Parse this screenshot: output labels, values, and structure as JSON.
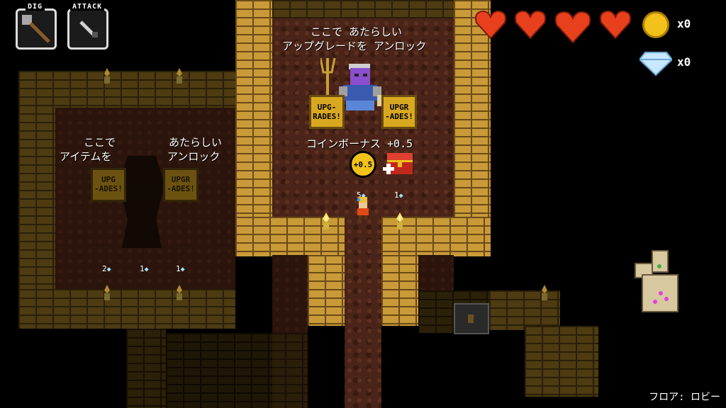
{
  "hud": {
    "dig_label": "DIG",
    "attack_label": "ATTACK",
    "hearts": 4,
    "coin_count": "x0",
    "diamond_count": "x0",
    "floor_label": "フロア: ロビー",
    "heart_color": "#e8401c",
    "coin_color": "#f2c21a",
    "diamond_color": "#c8e8ff"
  },
  "upgrade_room": {
    "title_line1": "ここで あたらしい",
    "title_line2": "アップグレードを アンロック",
    "bonus_label": "コインボーナス +0.5",
    "coin_badge": "+0.5",
    "sign_left": "UPG-\nRADES!",
    "sign_right": "UPGR\n-ADES!",
    "cost_left": "5",
    "cost_right": "1"
  },
  "item_room": {
    "label_left_1": "ここで",
    "label_left_2": "アイテムを",
    "label_right_1": "あたらしい",
    "label_right_2": "アンロック",
    "sign_left": "UPG\n-ADES!",
    "sign_right": "UPGR\n-ADES!",
    "cost_1": "2",
    "cost_2": "1",
    "cost_3": "1"
  }
}
